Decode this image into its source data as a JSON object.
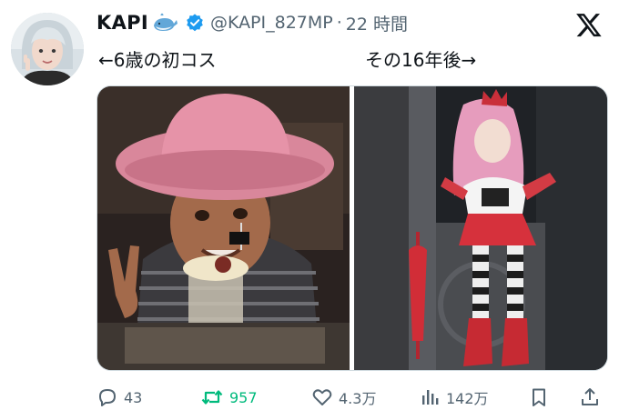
{
  "tweet": {
    "author_name": "KAPI",
    "handle": "@KAPI_827MP",
    "separator": "·",
    "timestamp": "22 時間",
    "text_left": "←6歳の初コス",
    "text_right": "その16年後→"
  },
  "actions": {
    "replies": "43",
    "retweets": "957",
    "likes": "4.3万",
    "views": "142万"
  },
  "colors": {
    "verified": "#1d9bf0",
    "retweet_active": "#00ba7c",
    "secondary_text": "#536471"
  },
  "icons": {
    "reply": "reply-icon",
    "retweet": "retweet-icon",
    "like": "heart-icon",
    "views": "views-icon",
    "bookmark": "bookmark-icon",
    "share": "share-icon",
    "logo": "x-logo-icon",
    "verified": "verified-badge-icon",
    "whale": "whale-emoji-icon"
  }
}
